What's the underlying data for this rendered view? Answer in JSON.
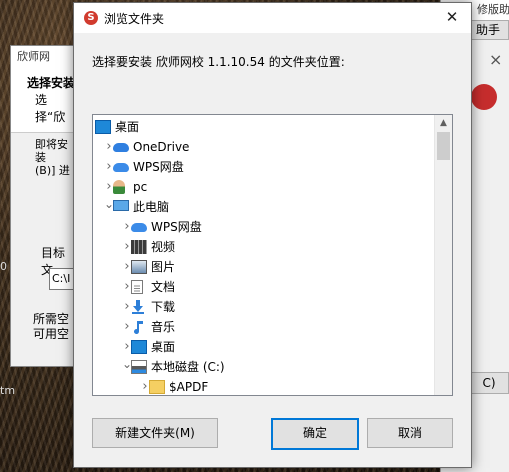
{
  "background": {
    "right_window": {
      "title": "修版助手",
      "tab_label": "助手",
      "close": "×",
      "button_label": "C)"
    },
    "left_window": {
      "title": "欣师网",
      "header_title": "选择安装",
      "header_sub": "选择“欣",
      "text1": "即将安装",
      "text1b": "(B)] 进",
      "target_label": "目标文",
      "target_value": "C:\\I",
      "space_required": "所需空",
      "space_available": "可用空"
    },
    "edge_text_1": "0",
    "edge_text_2": "tm"
  },
  "dialog": {
    "title": "浏览文件夹",
    "close_glyph": "✕",
    "message": "选择要安装 欣师网校 1.1.10.54 的文件夹位置:",
    "tree": [
      {
        "label": "桌面",
        "icon": "desktop-icon",
        "level": 0,
        "chevron": ""
      },
      {
        "label": "OneDrive",
        "icon": "onedrive-cloud-icon",
        "level": 1,
        "chevron": "›"
      },
      {
        "label": "WPS网盘",
        "icon": "wps-cloud-icon",
        "level": 1,
        "chevron": "›"
      },
      {
        "label": "pc",
        "icon": "user-icon",
        "level": 1,
        "chevron": "›"
      },
      {
        "label": "此电脑",
        "icon": "computer-icon",
        "level": 1,
        "chevron": "⌄"
      },
      {
        "label": "WPS网盘",
        "icon": "wps-cloud-icon",
        "level": 2,
        "chevron": "›"
      },
      {
        "label": "视频",
        "icon": "video-icon",
        "level": 2,
        "chevron": "›"
      },
      {
        "label": "图片",
        "icon": "pictures-icon",
        "level": 2,
        "chevron": "›"
      },
      {
        "label": "文档",
        "icon": "documents-icon",
        "level": 2,
        "chevron": "›"
      },
      {
        "label": "下载",
        "icon": "download-icon",
        "level": 2,
        "chevron": "›"
      },
      {
        "label": "音乐",
        "icon": "music-icon",
        "level": 2,
        "chevron": "›"
      },
      {
        "label": "桌面",
        "icon": "desktop-icon",
        "level": 2,
        "chevron": "›"
      },
      {
        "label": "本地磁盘 (C:)",
        "icon": "drive-icon",
        "level": 2,
        "chevron": "⌄"
      },
      {
        "label": "$APDF",
        "icon": "folder-icon",
        "level": 3,
        "chevron": "›"
      }
    ],
    "buttons": {
      "new_folder": "新建文件夹(M)",
      "ok": "确定",
      "cancel": "取消"
    },
    "scroll_up": "▲"
  },
  "colors": {
    "accent": "#0078d7",
    "selection_border": "#0078d7"
  }
}
